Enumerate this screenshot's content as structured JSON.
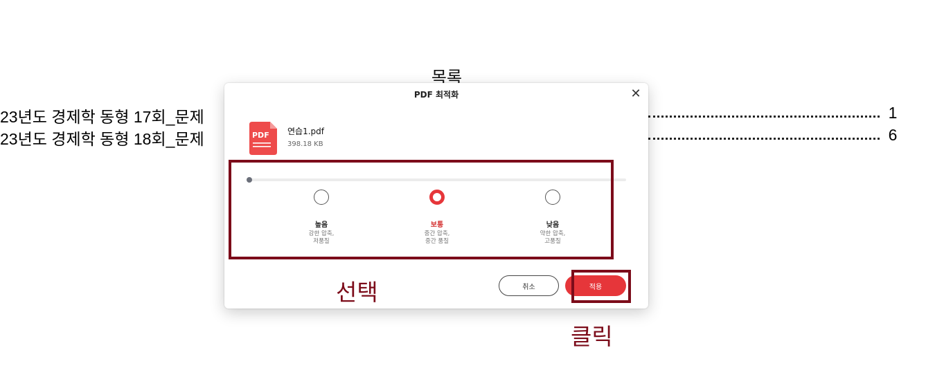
{
  "document": {
    "title": "목록",
    "toc": [
      {
        "text": "23년도 경제학 동형 17회_문제",
        "page": "1"
      },
      {
        "text": "23년도 경제학 동형 18회_문제",
        "page": "6"
      }
    ]
  },
  "dialog": {
    "title": "PDF 최적화",
    "close_icon": "close-icon",
    "file": {
      "icon": "pdf-file-icon",
      "icon_label": "PDF",
      "name": "연습1.pdf",
      "size": "398.18 KB"
    },
    "slider": {
      "handle": "slider-handle"
    },
    "options": [
      {
        "label": "높음",
        "desc_line1": "강한 압축,",
        "desc_line2": "저품질",
        "selected": false
      },
      {
        "label": "보통",
        "desc_line1": "중간 압축,",
        "desc_line2": "중간 품질",
        "selected": true
      },
      {
        "label": "낮음",
        "desc_line1": "약한 압축,",
        "desc_line2": "고품질",
        "selected": false
      }
    ],
    "cancel_label": "취소",
    "apply_label": "적용"
  },
  "annotations": {
    "select_label": "선택",
    "click_label": "클릭",
    "color": "#7c0c1a"
  },
  "colors": {
    "accent": "#e6363a"
  }
}
